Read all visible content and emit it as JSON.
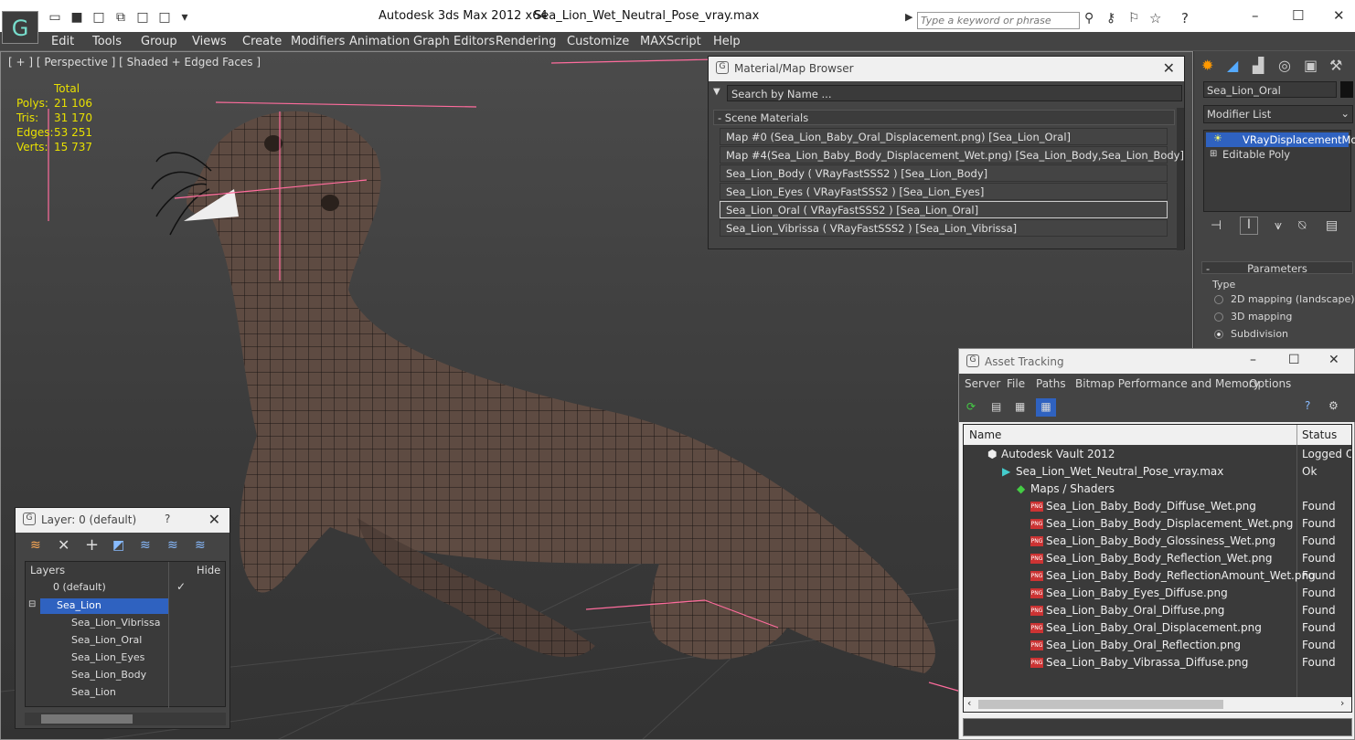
{
  "app": {
    "title": "Autodesk 3ds Max  2012 x64",
    "file": "Sea_Lion_Wet_Neutral_Pose_vray.max",
    "search_placeholder": "Type a keyword or phrase"
  },
  "menu": [
    "Edit",
    "Tools",
    "Group",
    "Views",
    "Create",
    "Modifiers",
    "Animation",
    "Graph Editors",
    "Rendering",
    "Customize",
    "MAXScript",
    "Help"
  ],
  "viewport": {
    "label": "[ + ] [ Perspective ] [ Shaded + Edged Faces ]",
    "stats": {
      "header": "Total",
      "rows": [
        {
          "k": "Polys:",
          "v": "21 106"
        },
        {
          "k": "Tris:",
          "v": "31 170"
        },
        {
          "k": "Edges:",
          "v": "53 251"
        },
        {
          "k": "Verts:",
          "v": "15 737"
        }
      ]
    }
  },
  "material_browser": {
    "title": "Material/Map Browser",
    "search": "Search by Name ...",
    "section": "- Scene Materials",
    "items": [
      "Map #0 (Sea_Lion_Baby_Oral_Displacement.png) [Sea_Lion_Oral]",
      "Map #4(Sea_Lion_Baby_Body_Displacement_Wet.png) [Sea_Lion_Body,Sea_Lion_Body]",
      "Sea_Lion_Body  ( VRayFastSSS2 ) [Sea_Lion_Body]",
      "Sea_Lion_Eyes  ( VRayFastSSS2 ) [Sea_Lion_Eyes]",
      "Sea_Lion_Oral  ( VRayFastSSS2 ) [Sea_Lion_Oral]",
      "Sea_Lion_Vibrissa  ( VRayFastSSS2 ) [Sea_Lion_Vibrissa]"
    ]
  },
  "command_panel": {
    "object_name": "Sea_Lion_Oral",
    "modifier_list": "Modifier List",
    "stack": [
      "VRayDisplacementMod",
      "Editable Poly"
    ],
    "parameters_title": "Parameters",
    "type_label": "Type",
    "type_options": [
      "2D mapping (landscape)",
      "3D mapping",
      "Subdivision"
    ]
  },
  "layer_panel": {
    "title": "Layer: 0 (default)",
    "help": "?",
    "col_layers": "Layers",
    "col_hide": "Hide",
    "rows": [
      "0 (default)",
      "Sea_Lion",
      "Sea_Lion_Vibrissa",
      "Sea_Lion_Oral",
      "Sea_Lion_Eyes",
      "Sea_Lion_Body",
      "Sea_Lion"
    ]
  },
  "asset_tracking": {
    "title": "Asset Tracking",
    "menu": [
      "Server",
      "File",
      "Paths",
      "Bitmap Performance and Memory",
      "Options"
    ],
    "col_name": "Name",
    "col_status": "Status",
    "rows": [
      {
        "name": "Autodesk Vault 2012",
        "status": "Logged Ou"
      },
      {
        "name": "Sea_Lion_Wet_Neutral_Pose_vray.max",
        "status": "Ok"
      },
      {
        "name": "Maps / Shaders",
        "status": ""
      },
      {
        "name": "Sea_Lion_Baby_Body_Diffuse_Wet.png",
        "status": "Found"
      },
      {
        "name": "Sea_Lion_Baby_Body_Displacement_Wet.png",
        "status": "Found"
      },
      {
        "name": "Sea_Lion_Baby_Body_Glossiness_Wet.png",
        "status": "Found"
      },
      {
        "name": "Sea_Lion_Baby_Body_Reflection_Wet.png",
        "status": "Found"
      },
      {
        "name": "Sea_Lion_Baby_Body_ReflectionAmount_Wet.png",
        "status": "Found"
      },
      {
        "name": "Sea_Lion_Baby_Eyes_Diffuse.png",
        "status": "Found"
      },
      {
        "name": "Sea_Lion_Baby_Oral_Diffuse.png",
        "status": "Found"
      },
      {
        "name": "Sea_Lion_Baby_Oral_Displacement.png",
        "status": "Found"
      },
      {
        "name": "Sea_Lion_Baby_Oral_Reflection.png",
        "status": "Found"
      },
      {
        "name": "Sea_Lion_Baby_Vibrassa_Diffuse.png",
        "status": "Found"
      }
    ]
  }
}
